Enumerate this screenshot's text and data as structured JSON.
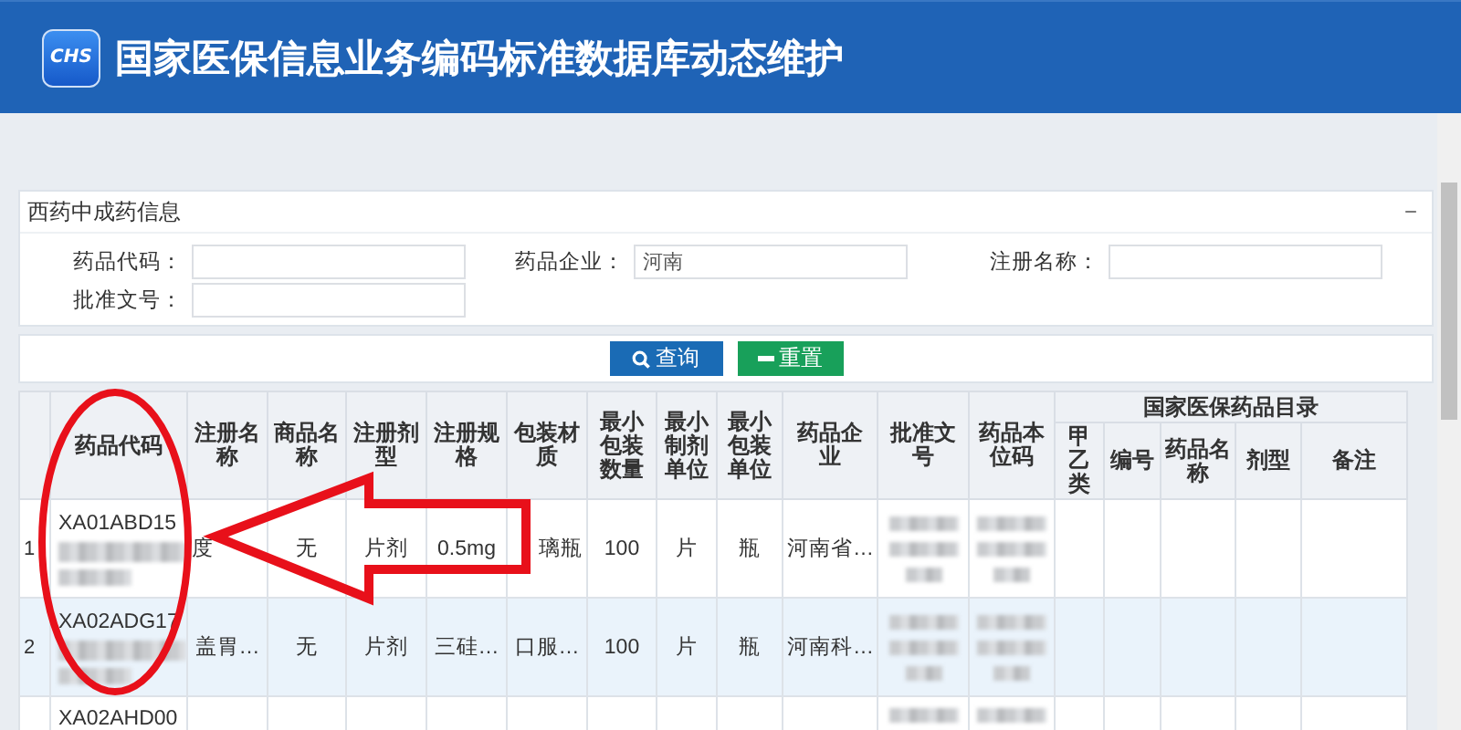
{
  "header": {
    "logo_text": "CHS",
    "title": "国家医保信息业务编码标准数据库动态维护"
  },
  "panel": {
    "title": "西药中成药信息",
    "collapse": "−"
  },
  "filters": [
    {
      "label": "药品代码："
    },
    {
      "label": "药品企业：",
      "value": "河南"
    },
    {
      "label": "注册名称："
    },
    {
      "label": "批准文号："
    }
  ],
  "buttons": [
    {
      "label": "查询",
      "kind": "search"
    },
    {
      "label": "重置",
      "kind": "reset"
    }
  ],
  "table": {
    "columns": [
      "药品代码",
      "注册名称",
      "商品名称",
      "注册剂型",
      "注册规格",
      "包装材质",
      "最小包装数量",
      "最小制剂单位",
      "最小包装单位",
      "药品企业",
      "批准文号",
      "药品本位码"
    ],
    "group": {
      "title": "国家医保药品目录",
      "columns": [
        "甲乙类",
        "编号",
        "药品名称",
        "剂型",
        "备注"
      ]
    },
    "rows": [
      {
        "index": "1",
        "selected": false,
        "cells": [
          {
            "kind": "code",
            "text": "XA01ABD15"
          },
          {
            "kind": "text_start",
            "text": "度"
          },
          {
            "kind": "text",
            "text": "无"
          },
          {
            "kind": "text",
            "text": "片剂"
          },
          {
            "kind": "text",
            "text": "0.5mg"
          },
          {
            "kind": "text_end",
            "text": "璃瓶"
          },
          {
            "kind": "text",
            "text": "100"
          },
          {
            "kind": "text",
            "text": "片"
          },
          {
            "kind": "text",
            "text": "瓶"
          },
          {
            "kind": "text",
            "text": "河南省…"
          },
          {
            "kind": "blurred"
          },
          {
            "kind": "blurred"
          },
          {
            "kind": "empty"
          },
          {
            "kind": "empty"
          },
          {
            "kind": "empty"
          },
          {
            "kind": "empty"
          },
          {
            "kind": "empty"
          }
        ]
      },
      {
        "index": "2",
        "selected": true,
        "cells": [
          {
            "kind": "code",
            "text": "XA02ADG17"
          },
          {
            "kind": "text",
            "text": "盖胃…"
          },
          {
            "kind": "text",
            "text": "无"
          },
          {
            "kind": "text",
            "text": "片剂"
          },
          {
            "kind": "text",
            "text": "三硅…"
          },
          {
            "kind": "text",
            "text": "口服…"
          },
          {
            "kind": "text",
            "text": "100"
          },
          {
            "kind": "text",
            "text": "片"
          },
          {
            "kind": "text",
            "text": "瓶"
          },
          {
            "kind": "text",
            "text": "河南科…"
          },
          {
            "kind": "blurred"
          },
          {
            "kind": "blurred"
          },
          {
            "kind": "empty"
          },
          {
            "kind": "empty"
          },
          {
            "kind": "empty"
          },
          {
            "kind": "empty"
          },
          {
            "kind": "empty"
          }
        ]
      },
      {
        "selected": false,
        "cells": [
          {
            "kind": "code",
            "text": "XA02AHD00"
          },
          {
            "kind": "empty"
          },
          {
            "kind": "empty"
          },
          {
            "kind": "empty"
          },
          {
            "kind": "empty"
          },
          {
            "kind": "empty"
          },
          {
            "kind": "empty"
          },
          {
            "kind": "empty"
          },
          {
            "kind": "empty"
          },
          {
            "kind": "empty"
          },
          {
            "kind": "blurred"
          },
          {
            "kind": "blurred"
          },
          {
            "kind": "empty"
          },
          {
            "kind": "empty"
          },
          {
            "kind": "empty"
          },
          {
            "kind": "empty"
          },
          {
            "kind": "empty"
          }
        ]
      }
    ]
  },
  "annotations": {
    "ellipse": true,
    "arrow": true
  }
}
